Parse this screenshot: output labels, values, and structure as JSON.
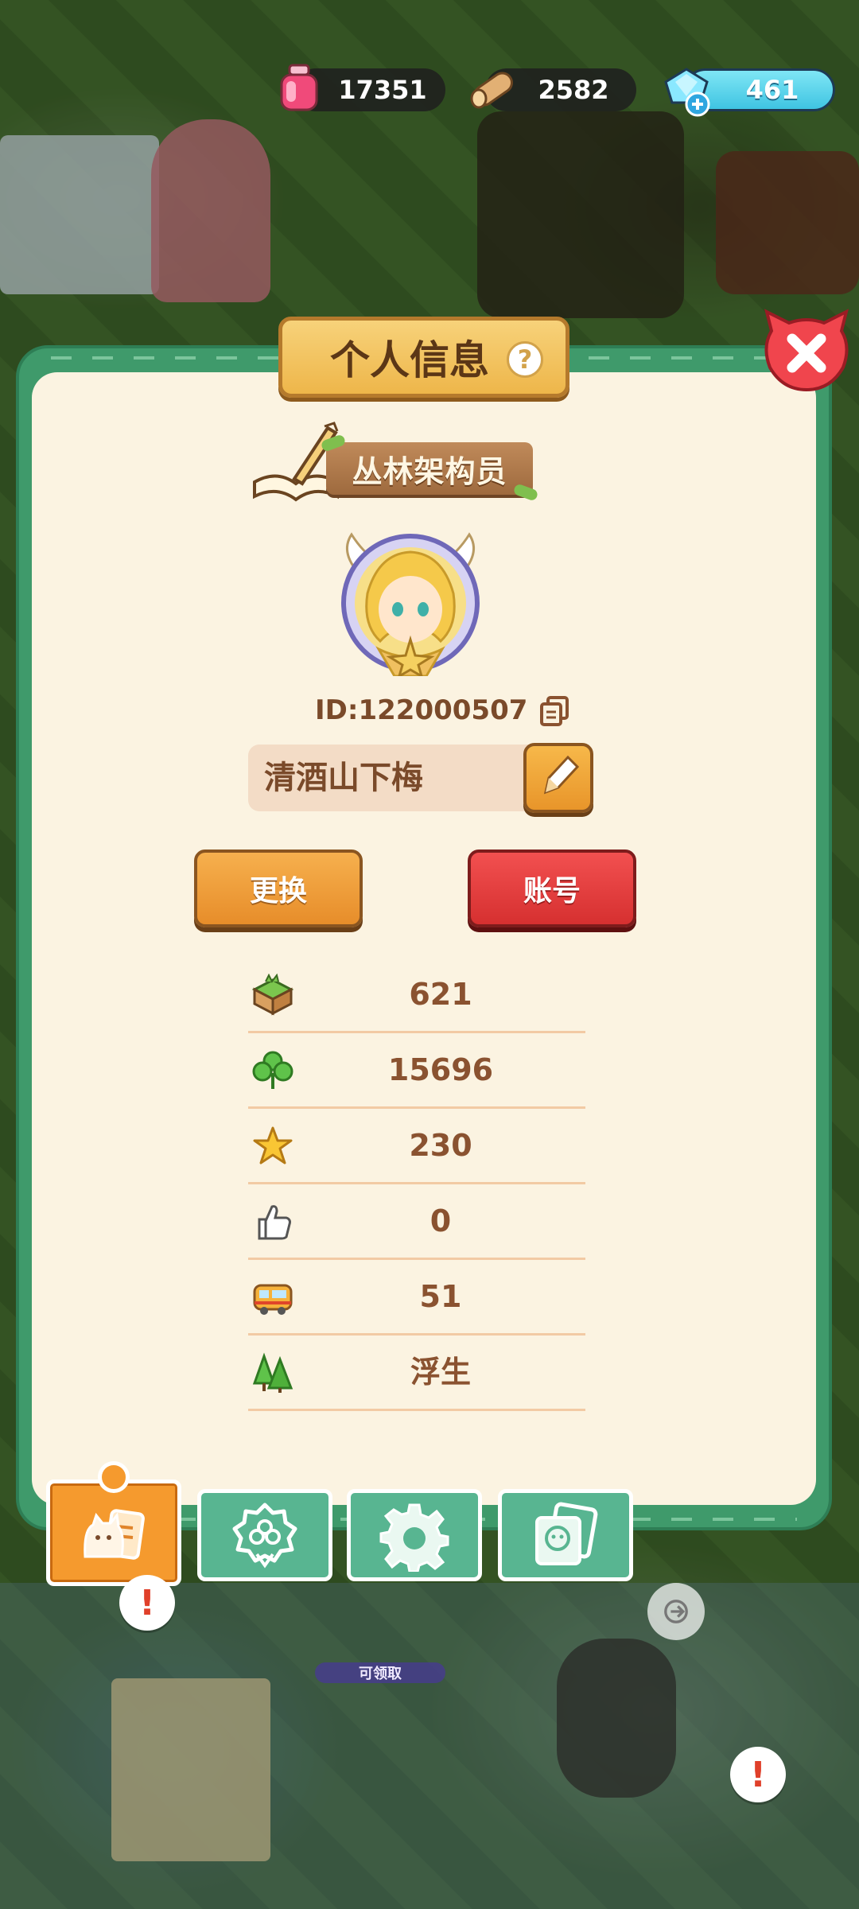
{
  "resources": {
    "ink": "17351",
    "wood": "2582",
    "gems": "461"
  },
  "panel": {
    "title": "个人信息",
    "help_symbol": "?",
    "rank_title": "丛林架构员",
    "player_id": "ID:122000507",
    "player_name": "清酒山下梅",
    "change_button": "更换",
    "account_button": "账号"
  },
  "stats": [
    {
      "icon": "grass-block-icon",
      "value": "621"
    },
    {
      "icon": "clover-icon",
      "value": "15696"
    },
    {
      "icon": "star-icon",
      "value": "230"
    },
    {
      "icon": "thumbs-up-icon",
      "value": "0"
    },
    {
      "icon": "bus-icon",
      "value": "51"
    },
    {
      "icon": "trees-icon",
      "value": "浮生"
    }
  ],
  "tabs": [
    {
      "name": "profile",
      "icon": "cat-card-icon",
      "active": true
    },
    {
      "name": "badges",
      "icon": "medal-icon",
      "active": false
    },
    {
      "name": "settings",
      "icon": "gear-icon",
      "active": false
    },
    {
      "name": "album",
      "icon": "photo-album-icon",
      "active": false
    }
  ],
  "world": {
    "claim_label": "可领取",
    "alert_symbol": "!"
  },
  "colors": {
    "panel_green": "#3f9a6b",
    "panel_cream": "#fbf3e1",
    "accent_orange": "#f59a2e",
    "accent_red": "#d63030",
    "text_brown": "#8a5230"
  }
}
